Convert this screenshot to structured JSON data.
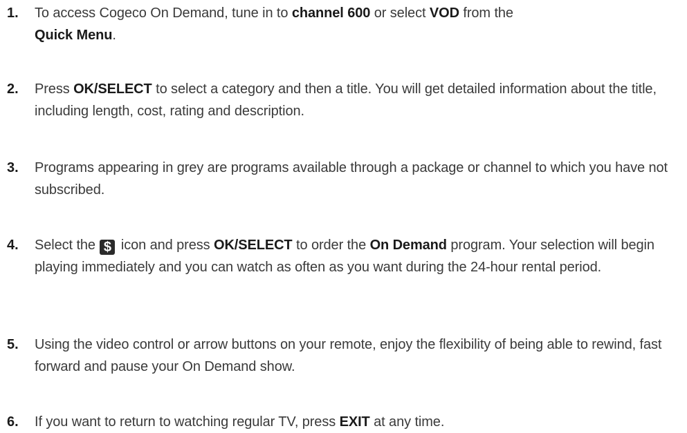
{
  "steps": [
    {
      "number": "1.",
      "parts": [
        "To access Cogeco On Demand, tune in to ",
        "channel 600",
        " or select ",
        "VOD",
        " from the ",
        "Quick Menu",
        "."
      ]
    },
    {
      "number": "2.",
      "parts": [
        "Press ",
        "OK/SELECT",
        " to select a category and then a title. You will get detailed information about the title, including length, cost, rating and description."
      ]
    },
    {
      "number": "3.",
      "parts": [
        "Programs appearing in grey are programs available through a package or channel to which you have not subscribed."
      ]
    },
    {
      "number": "4.",
      "parts": [
        "Select the ",
        " icon and press ",
        "OK/SELECT",
        " to order the ",
        "On Demand",
        " program. Your selection will begin playing immediately and you can watch as often as you want during the 24-hour rental period."
      ],
      "icon": {
        "name": "dollar-icon",
        "glyph": "$"
      }
    },
    {
      "number": "5.",
      "parts": [
        "Using the video control or arrow buttons on your remote, enjoy the flexibility of being able to rewind, fast forward and pause your On Demand show."
      ]
    },
    {
      "number": "6.",
      "parts": [
        "If you want to return to watching regular TV, press ",
        "EXIT",
        " at any time."
      ]
    }
  ]
}
